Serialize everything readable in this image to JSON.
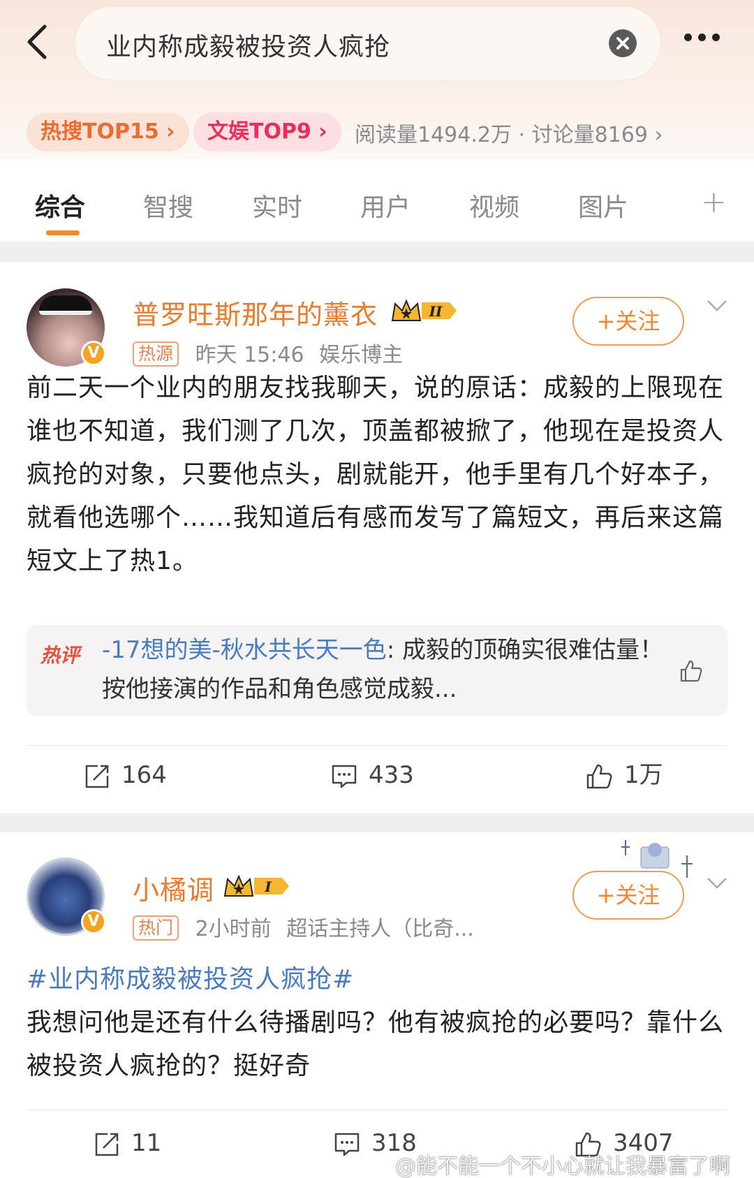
{
  "search": {
    "query": "业内称成毅被投资人疯抢"
  },
  "topic_bar": {
    "hot_search_tag": "热搜TOP15",
    "entertainment_tag": "文娱TOP9",
    "stats": "阅读量1494.2万 · 讨论量8169"
  },
  "tabs": [
    {
      "label": "综合"
    },
    {
      "label": "智搜"
    },
    {
      "label": "实时"
    },
    {
      "label": "用户"
    },
    {
      "label": "视频"
    },
    {
      "label": "图片"
    }
  ],
  "posts": [
    {
      "username": "普罗旺斯那年的薰衣",
      "member_level": "II",
      "source_tag": "热源",
      "time": "昨天 15:46",
      "role": "娱乐博主",
      "follow_label": "+关注",
      "text": "前二天一个业内的朋友找我聊天，说的原话：成毅的上限现在谁也不知道，我们测了几次，顶盖都被掀了，他现在是投资人疯抢的对象，只要他点头，剧就能开，他手里有几个好本子，就看他选哪个……我知道后有感而发写了篇短文，再后来这篇短文上了热1。",
      "hot_comment": {
        "label": "热评",
        "author": "-17想的美-秋水共长天一色",
        "text": ": 成毅的顶确实很难估量！按他接演的作品和角色感觉成毅..."
      },
      "reposts": "164",
      "comments": "433",
      "likes": "1万"
    },
    {
      "username": "小橘调",
      "member_level": "I",
      "source_tag": "热门",
      "time": "2小时前",
      "role": "超话主持人（比奇...",
      "follow_label": "+关注",
      "hashtag": "#业内称成毅被投资人疯抢#",
      "text": "我想问他是还有什么待播剧吗？他有被疯抢的必要吗？靠什么被投资人疯抢的？挺好奇",
      "reposts": "11",
      "comments": "318",
      "likes": "3407"
    }
  ],
  "watermark": "@能不能一个不小心就让我暴富了啊",
  "colors": {
    "accent_orange": "#f2882b",
    "username_orange": "#eb7b2c",
    "link_blue": "#4a7cbd",
    "hot_red": "#e8503a"
  }
}
